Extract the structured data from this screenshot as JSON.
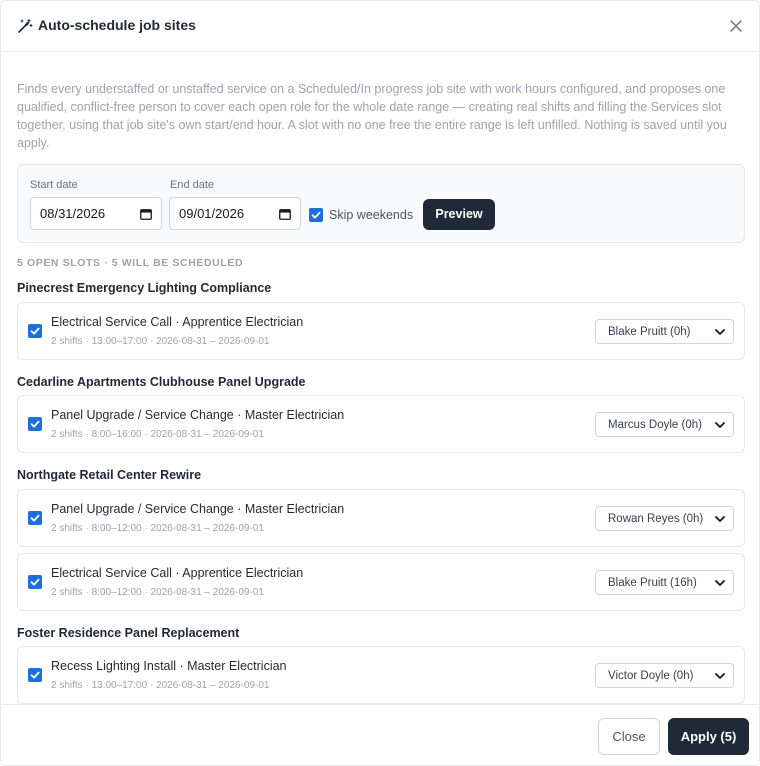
{
  "dialog": {
    "title": "Auto-schedule job sites",
    "description": "Finds every understaffed or unstaffed service on a Scheduled/In progress job site with work hours configured, and proposes one qualified, conflict-free person to cover each open role for the whole date range — creating real shifts and filling the Services slot together, using that job site's own start/end hour. A slot with no one free the entire range is left unfilled. Nothing is saved until you apply."
  },
  "filters": {
    "start_label": "Start date",
    "start_value": "08/31/2026",
    "end_label": "End date",
    "end_value": "09/01/2026",
    "skip_weekends_label": "Skip weekends",
    "skip_weekends_checked": true,
    "preview_label": "Preview"
  },
  "summary": "5 OPEN SLOTS · 5 WILL BE SCHEDULED",
  "sites": [
    {
      "name": "Pinecrest Emergency Lighting Compliance",
      "slots": [
        {
          "role": "Electrical Service Call · Apprentice Electrician",
          "meta": "2 shifts · 13:00–17:00 · 2026-08-31 – 2026-09-01",
          "assignee": "Blake Pruitt (0h)",
          "checked": true
        }
      ]
    },
    {
      "name": "Cedarline Apartments Clubhouse Panel Upgrade",
      "slots": [
        {
          "role": "Panel Upgrade / Service Change · Master Electrician",
          "meta": "2 shifts · 8:00–16:00 · 2026-08-31 – 2026-09-01",
          "assignee": "Marcus Doyle (0h)",
          "checked": true
        }
      ]
    },
    {
      "name": "Northgate Retail Center Rewire",
      "slots": [
        {
          "role": "Panel Upgrade / Service Change · Master Electrician",
          "meta": "2 shifts · 8:00–12:00 · 2026-08-31 – 2026-09-01",
          "assignee": "Rowan Reyes (0h)",
          "checked": true
        },
        {
          "role": "Electrical Service Call · Apprentice Electrician",
          "meta": "2 shifts · 8:00–12:00 · 2026-08-31 – 2026-09-01",
          "assignee": "Blake Pruitt (16h)",
          "checked": true
        }
      ]
    },
    {
      "name": "Foster Residence Panel Replacement",
      "slots": [
        {
          "role": "Recess Lighting Install · Master Electrician",
          "meta": "2 shifts · 13:00–17:00 · 2026-08-31 – 2026-09-01",
          "assignee": "Victor Doyle (0h)",
          "checked": true
        }
      ]
    }
  ],
  "footer": {
    "close_label": "Close",
    "apply_label": "Apply (5)"
  },
  "colors": {
    "accent_dark": "#1f2937",
    "checkbox_blue": "#1d6fdc"
  },
  "icons": {
    "title_icon": "magic-wand-icon",
    "close_icon": "close-icon",
    "date_icon": "calendar-icon",
    "select_icon": "chevron-down-icon"
  }
}
